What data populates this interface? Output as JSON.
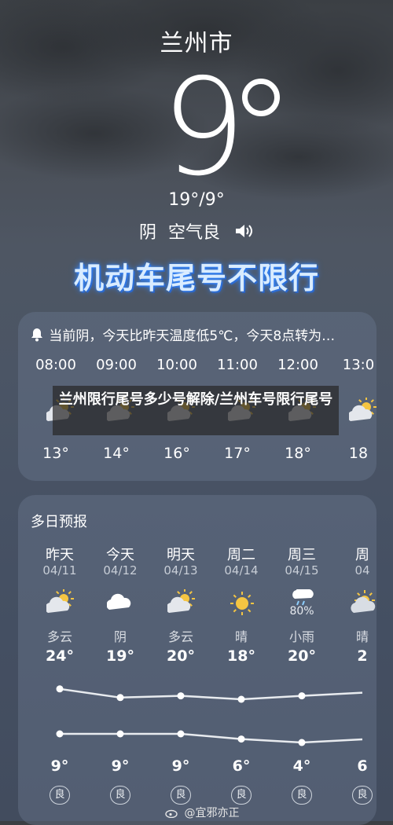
{
  "header": {
    "city": "兰州市",
    "temperature": "9",
    "hi_lo": "19°/9°",
    "condition": "阴",
    "aqi": "空气良",
    "headline": "机动车尾号不限行"
  },
  "hourly_card": {
    "alert": "当前阴，今天比昨天温度低5℃，今天8点转为…",
    "hours": [
      {
        "time": "08:00",
        "icon": "partly-cloudy-icon",
        "temp": "13°"
      },
      {
        "time": "09:00",
        "icon": "partly-cloudy-icon",
        "temp": "14°"
      },
      {
        "time": "10:00",
        "icon": "partly-cloudy-icon",
        "temp": "16°"
      },
      {
        "time": "11:00",
        "icon": "partly-cloudy-icon",
        "temp": "17°"
      },
      {
        "time": "12:00",
        "icon": "partly-cloudy-icon",
        "temp": "18°"
      },
      {
        "time": "13:0",
        "icon": "partly-cloudy-icon",
        "temp": "18"
      }
    ]
  },
  "overlay": {
    "text": "兰州限行尾号多少号解除/兰州车号限行尾号"
  },
  "multi_day": {
    "title": "多日预报",
    "days": [
      {
        "name": "昨天",
        "date": "04/11",
        "icon": "partly-cloudy-icon",
        "precip": "",
        "cond": "多云",
        "hi": "24°",
        "lo": "9°",
        "aqi": "良"
      },
      {
        "name": "今天",
        "date": "04/12",
        "icon": "cloudy-icon",
        "precip": "",
        "cond": "阴",
        "hi": "19°",
        "lo": "9°",
        "aqi": "良"
      },
      {
        "name": "明天",
        "date": "04/13",
        "icon": "partly-cloudy-icon",
        "precip": "",
        "cond": "多云",
        "hi": "20°",
        "lo": "9°",
        "aqi": "良"
      },
      {
        "name": "周二",
        "date": "04/14",
        "icon": "sunny-icon",
        "precip": "",
        "cond": "晴",
        "hi": "18°",
        "lo": "6°",
        "aqi": "良"
      },
      {
        "name": "周三",
        "date": "04/15",
        "icon": "light-rain-icon",
        "precip": "80%",
        "cond": "小雨",
        "hi": "20°",
        "lo": "4°",
        "aqi": "良"
      },
      {
        "name": "周",
        "date": "04",
        "icon": "partly-sunny-icon",
        "precip": "",
        "cond": "晴",
        "hi": "2",
        "lo": "6",
        "aqi": "良"
      }
    ]
  },
  "watermark": "@宜邪亦正",
  "colors": {
    "headline": "#d9ecff",
    "headline_glow": "#3a8cff",
    "card": "#69768c",
    "line": "#e8ebef"
  }
}
